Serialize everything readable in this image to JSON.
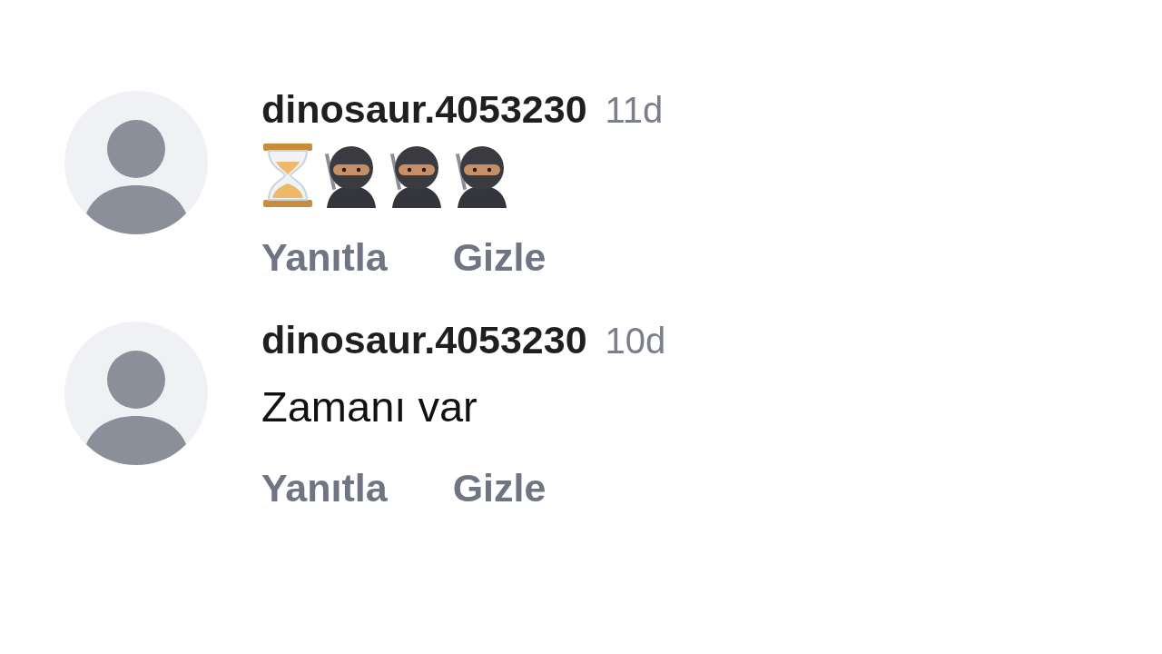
{
  "comments": [
    {
      "username": "dinosaur.4053230",
      "time": "11d",
      "body": {
        "kind": "icons",
        "icons": [
          {
            "kind": "hourglass"
          },
          {
            "kind": "ninja"
          },
          {
            "kind": "ninja"
          },
          {
            "kind": "ninja"
          }
        ]
      },
      "actions": [
        "Yanıtla",
        "Gizle"
      ]
    },
    {
      "username": "dinosaur.4053230",
      "time": "10d",
      "body": {
        "kind": "text",
        "text": "Zamanı var"
      },
      "actions": [
        "Yanıtla",
        "Gizle"
      ]
    }
  ]
}
